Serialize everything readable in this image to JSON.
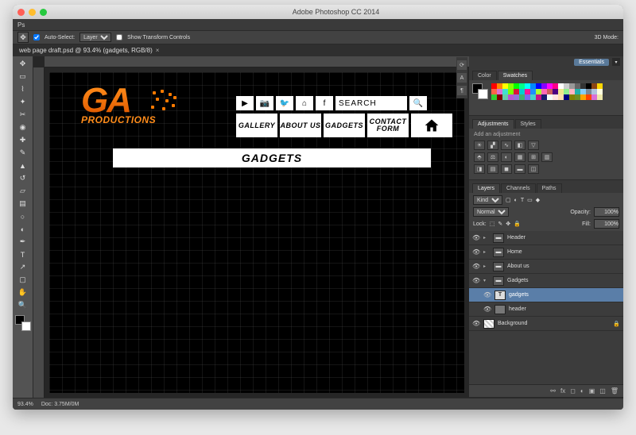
{
  "app": {
    "title": "Adobe Photoshop CC 2014"
  },
  "menubar": [
    "Ps"
  ],
  "options": {
    "auto_select_label": "Auto-Select:",
    "auto_select_value": "Layer",
    "show_transform_label": "Show Transform Controls",
    "extra": "3D Mode:"
  },
  "document": {
    "tab_label": "web page draft.psd @ 93.4% (gadgets, RGB/8)",
    "close": "×"
  },
  "workspace": {
    "essentials": "Essentials"
  },
  "canvas": {
    "logo_main": "GA",
    "logo_sub": "PRODUCTIONS",
    "social": [
      "▶",
      "📷",
      "🐦",
      "⌂",
      "f"
    ],
    "search_label": "SEARCH",
    "search_icon": "🔍",
    "nav": [
      "GALLERY",
      "ABOUT US",
      "GADGETS",
      "CONTACT FORM"
    ],
    "page_title": "GADGETS"
  },
  "panels": {
    "color_tab": "Color",
    "swatches_tab": "Swatches",
    "adjustments_tab": "Adjustments",
    "styles_tab": "Styles",
    "adjustments_hint": "Add an adjustment",
    "layers_tab": "Layers",
    "channels_tab": "Channels",
    "paths_tab": "Paths"
  },
  "layers": {
    "kind_label": "Kind",
    "blend_mode": "Normal",
    "opacity_label": "Opacity:",
    "opacity_value": "100%",
    "lock_label": "Lock:",
    "fill_label": "Fill:",
    "fill_value": "100%",
    "items": [
      {
        "type": "folder",
        "name": "Header",
        "indent": 0,
        "open": false,
        "sel": false,
        "vis": true
      },
      {
        "type": "folder",
        "name": "Home",
        "indent": 0,
        "open": false,
        "sel": false,
        "vis": true
      },
      {
        "type": "folder",
        "name": "About us",
        "indent": 0,
        "open": false,
        "sel": false,
        "vis": true
      },
      {
        "type": "folder",
        "name": "Gadgets",
        "indent": 0,
        "open": true,
        "sel": false,
        "vis": true
      },
      {
        "type": "text",
        "name": "gadgets",
        "indent": 1,
        "sel": true,
        "vis": true
      },
      {
        "type": "layer",
        "name": "header",
        "indent": 1,
        "sel": false,
        "vis": true
      },
      {
        "type": "bg",
        "name": "Background",
        "indent": 0,
        "sel": false,
        "vis": true,
        "locked": true
      }
    ]
  },
  "status": {
    "zoom": "93.4%",
    "doc": "Doc: 3.75M/0M"
  },
  "swatch_colors": [
    "#ff0000",
    "#ff8800",
    "#ffff00",
    "#88ff00",
    "#00ff00",
    "#00ff88",
    "#00ffff",
    "#0088ff",
    "#0000ff",
    "#8800ff",
    "#ff00ff",
    "#ff0088",
    "#ffffff",
    "#cccccc",
    "#999999",
    "#666666",
    "#333333",
    "#000000",
    "#8b4513",
    "#ffd700",
    "#ff6347",
    "#da70d6",
    "#40e0d0",
    "#7fff00",
    "#dc143c",
    "#00ced1",
    "#ff1493",
    "#1e90ff",
    "#adff2f",
    "#ff69b4",
    "#cd5c5c",
    "#4b0082",
    "#f0e68c",
    "#90ee90",
    "#ffb6c1",
    "#20b2aa",
    "#87cefa",
    "#778899",
    "#b0c4de",
    "#ffffe0",
    "#32cd32",
    "#800000",
    "#66cdaa",
    "#ba55d3",
    "#9370db",
    "#3cb371",
    "#7b68ee",
    "#48d1cc",
    "#c71585",
    "#191970",
    "#f5fffa",
    "#ffe4e1",
    "#ffdead",
    "#000080",
    "#808000",
    "#6b8e23",
    "#ffa500",
    "#ff4500",
    "#da70d6",
    "#eee8aa"
  ]
}
